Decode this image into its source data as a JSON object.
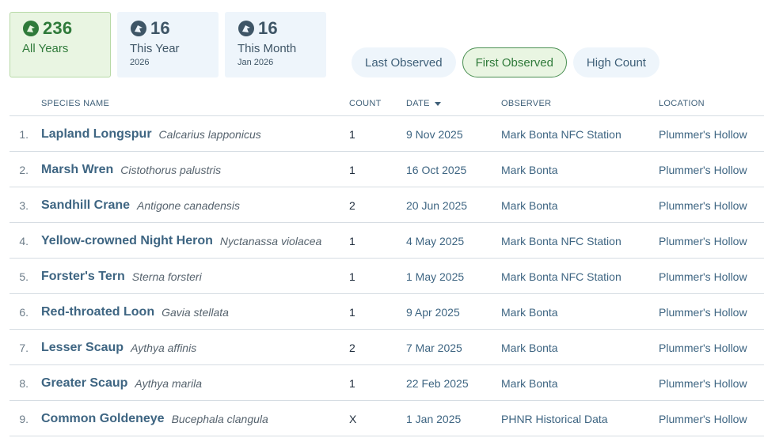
{
  "stats": [
    {
      "number": "236",
      "label": "All Years",
      "sub": "",
      "active": true
    },
    {
      "number": "16",
      "label": "This Year",
      "sub": "2026",
      "active": false
    },
    {
      "number": "16",
      "label": "This Month",
      "sub": "Jan 2026",
      "active": false
    }
  ],
  "sort_tabs": [
    {
      "label": "Last Observed",
      "active": false
    },
    {
      "label": "First Observed",
      "active": true
    },
    {
      "label": "High Count",
      "active": false
    }
  ],
  "table": {
    "headers": {
      "species": "SPECIES NAME",
      "count": "COUNT",
      "date": "DATE",
      "observer": "OBSERVER",
      "location": "LOCATION"
    },
    "rows": [
      {
        "num": "1.",
        "common": "Lapland Longspur",
        "sci": "Calcarius lapponicus",
        "count": "1",
        "date": "9 Nov 2025",
        "observer": "Mark Bonta NFC Station",
        "location": "Plummer's Hollow"
      },
      {
        "num": "2.",
        "common": "Marsh Wren",
        "sci": "Cistothorus palustris",
        "count": "1",
        "date": "16 Oct 2025",
        "observer": "Mark Bonta",
        "location": "Plummer's Hollow"
      },
      {
        "num": "3.",
        "common": "Sandhill Crane",
        "sci": "Antigone canadensis",
        "count": "2",
        "date": "20 Jun 2025",
        "observer": "Mark Bonta",
        "location": "Plummer's Hollow"
      },
      {
        "num": "4.",
        "common": "Yellow-crowned Night Heron",
        "sci": "Nyctanassa violacea",
        "count": "1",
        "date": "4 May 2025",
        "observer": "Mark Bonta NFC Station",
        "location": "Plummer's Hollow"
      },
      {
        "num": "5.",
        "common": "Forster's Tern",
        "sci": "Sterna forsteri",
        "count": "1",
        "date": "1 May 2025",
        "observer": "Mark Bonta NFC Station",
        "location": "Plummer's Hollow"
      },
      {
        "num": "6.",
        "common": "Red-throated Loon",
        "sci": "Gavia stellata",
        "count": "1",
        "date": "9 Apr 2025",
        "observer": "Mark Bonta",
        "location": "Plummer's Hollow"
      },
      {
        "num": "7.",
        "common": "Lesser Scaup",
        "sci": "Aythya affinis",
        "count": "2",
        "date": "7 Mar 2025",
        "observer": "Mark Bonta",
        "location": "Plummer's Hollow"
      },
      {
        "num": "8.",
        "common": "Greater Scaup",
        "sci": "Aythya marila",
        "count": "1",
        "date": "22 Feb 2025",
        "observer": "Mark Bonta",
        "location": "Plummer's Hollow"
      },
      {
        "num": "9.",
        "common": "Common Goldeneye",
        "sci": "Bucephala clangula",
        "count": "X",
        "date": "1 Jan 2025",
        "observer": "PHNR Historical Data",
        "location": "Plummer's Hollow"
      }
    ]
  },
  "icons": {
    "stat": "species-tally-icon",
    "sort": "sort-descending-icon"
  },
  "colors": {
    "accent_green": "#2f7a3a",
    "link_blue": "#3e6582",
    "tile_bg": "#eef5fb",
    "active_bg": "#e9f5e2"
  }
}
